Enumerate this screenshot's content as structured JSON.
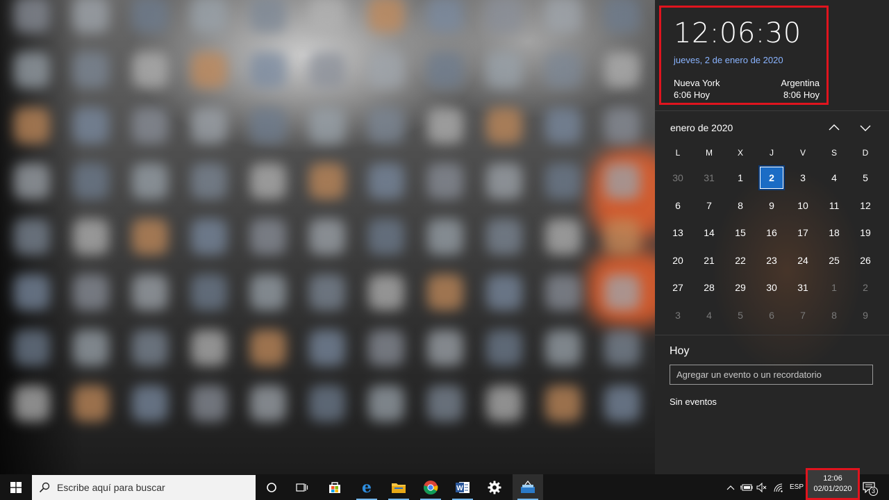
{
  "flyout": {
    "time": "12:06:30",
    "date_link": "jueves, 2 de enero de 2020",
    "timezones": [
      {
        "city": "Nueva York",
        "time": "6:06 Hoy"
      },
      {
        "city": "Argentina",
        "time": "8:06 Hoy"
      }
    ]
  },
  "calendar": {
    "month_title": "enero de 2020",
    "weekdays": [
      "L",
      "M",
      "X",
      "J",
      "V",
      "S",
      "D"
    ],
    "weeks": [
      [
        {
          "d": "30",
          "dim": true
        },
        {
          "d": "31",
          "dim": true
        },
        {
          "d": "1"
        },
        {
          "d": "2",
          "today": true
        },
        {
          "d": "3"
        },
        {
          "d": "4"
        },
        {
          "d": "5"
        }
      ],
      [
        {
          "d": "6"
        },
        {
          "d": "7"
        },
        {
          "d": "8"
        },
        {
          "d": "9"
        },
        {
          "d": "10"
        },
        {
          "d": "11"
        },
        {
          "d": "12"
        }
      ],
      [
        {
          "d": "13"
        },
        {
          "d": "14"
        },
        {
          "d": "15"
        },
        {
          "d": "16"
        },
        {
          "d": "17"
        },
        {
          "d": "18"
        },
        {
          "d": "19"
        }
      ],
      [
        {
          "d": "20"
        },
        {
          "d": "21"
        },
        {
          "d": "22"
        },
        {
          "d": "23"
        },
        {
          "d": "24"
        },
        {
          "d": "25"
        },
        {
          "d": "26"
        }
      ],
      [
        {
          "d": "27"
        },
        {
          "d": "28"
        },
        {
          "d": "29"
        },
        {
          "d": "30"
        },
        {
          "d": "31"
        },
        {
          "d": "1",
          "dim": true
        },
        {
          "d": "2",
          "dim": true
        }
      ],
      [
        {
          "d": "3",
          "dim": true
        },
        {
          "d": "4",
          "dim": true
        },
        {
          "d": "5",
          "dim": true
        },
        {
          "d": "6",
          "dim": true
        },
        {
          "d": "7",
          "dim": true
        },
        {
          "d": "8",
          "dim": true
        },
        {
          "d": "9",
          "dim": true
        }
      ]
    ],
    "nav_icons": [
      "chevron-up-icon",
      "chevron-down-icon"
    ]
  },
  "agenda": {
    "title": "Hoy",
    "event_placeholder": "Agregar un evento o un recordatorio",
    "no_events": "Sin eventos"
  },
  "taskbar": {
    "search_placeholder": "Escribe aquí para buscar",
    "pinned_apps": [
      "cortana-icon",
      "task-view-icon",
      "store-icon",
      "edge-icon",
      "file-explorer-icon",
      "chrome-icon",
      "word-icon",
      "settings-icon",
      "app-icon"
    ],
    "language": "ESP",
    "clock_time": "12:06",
    "clock_date": "02/01/2020",
    "notification_count": "3"
  },
  "colors": {
    "panel_bg": "#262626",
    "accent": "#1b6cc5",
    "highlight_frame": "#e0141e",
    "date_link": "#8ab4ff",
    "taskbar_bg": "#141414"
  }
}
